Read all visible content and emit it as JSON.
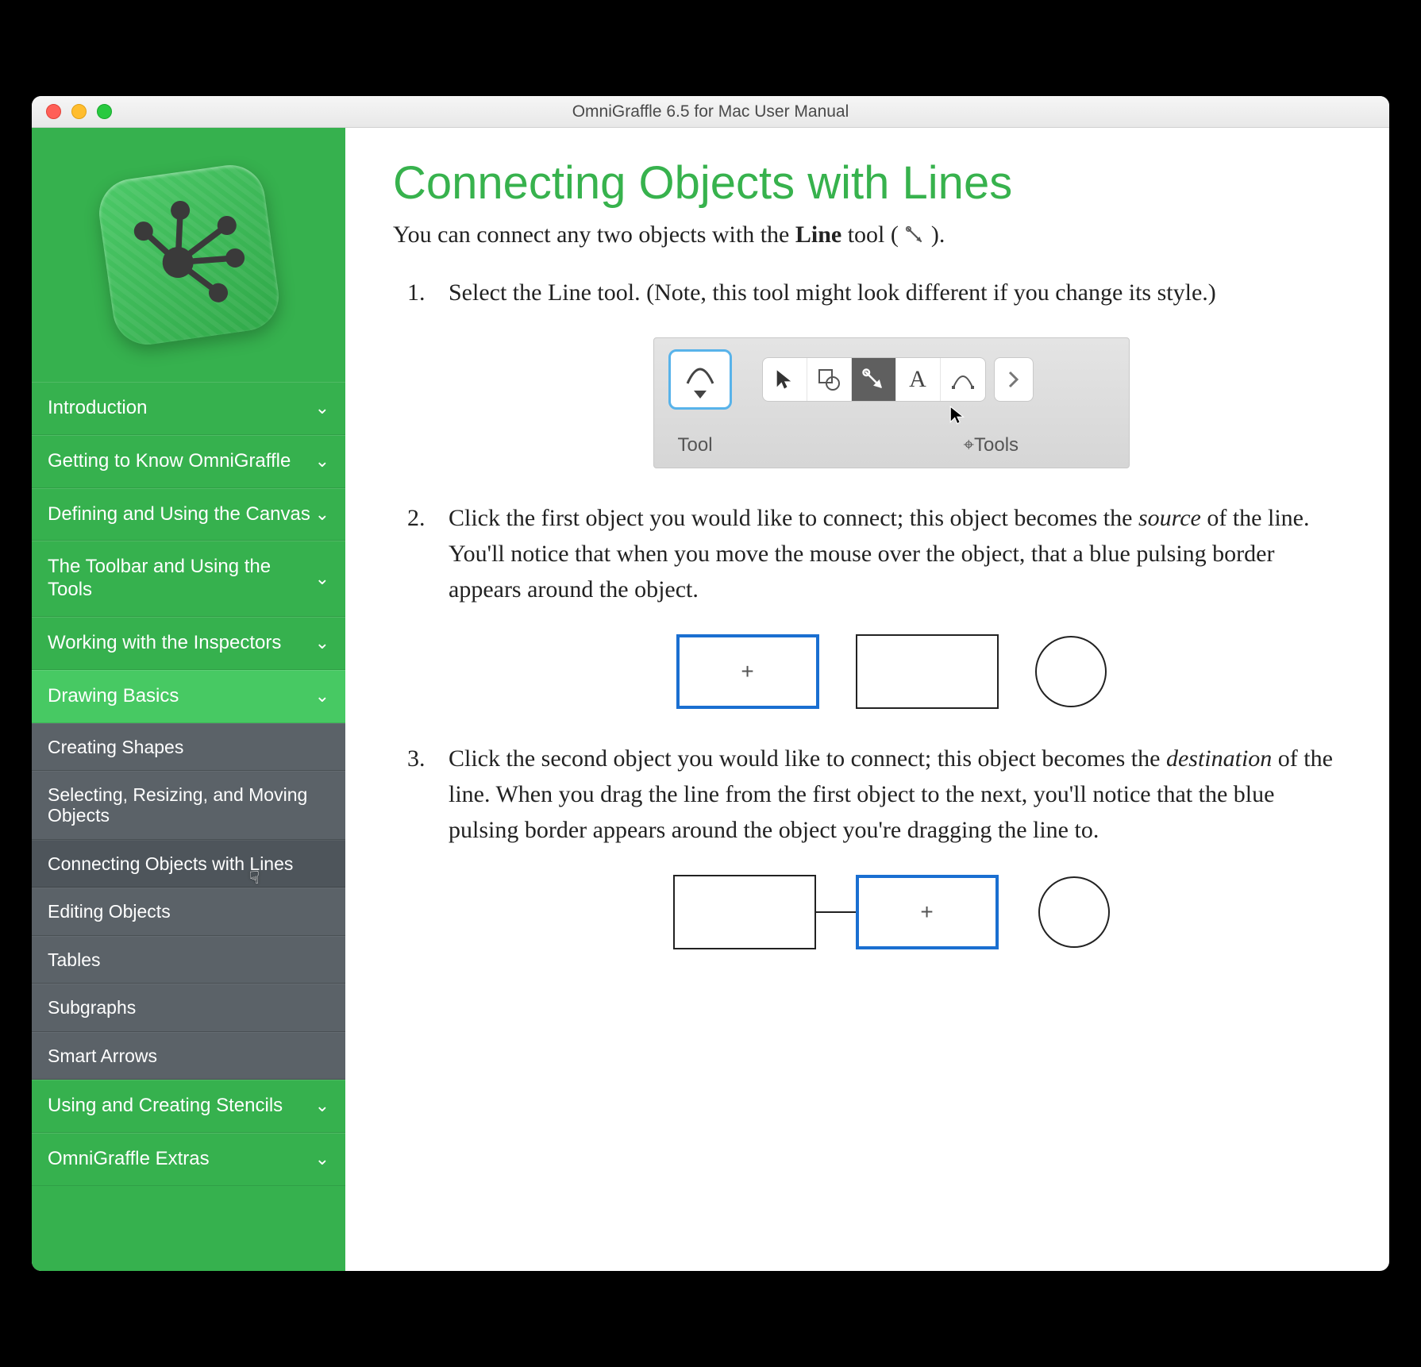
{
  "window": {
    "title": "OmniGraffle 6.5 for Mac User Manual"
  },
  "sidebar": {
    "sections": [
      {
        "label": "Introduction"
      },
      {
        "label": "Getting to Know OmniGraffle"
      },
      {
        "label": "Defining and Using the Canvas"
      },
      {
        "label": "The Toolbar and Using the Tools"
      },
      {
        "label": "Working with the Inspectors"
      },
      {
        "label": "Drawing Basics"
      },
      {
        "label": "Using and Creating Stencils"
      },
      {
        "label": "OmniGraffle Extras"
      }
    ],
    "drawing_basics_children": [
      {
        "label": "Creating Shapes"
      },
      {
        "label": "Selecting, Resizing, and Moving Objects"
      },
      {
        "label": "Connecting Objects with Lines"
      },
      {
        "label": "Editing Objects"
      },
      {
        "label": "Tables"
      },
      {
        "label": "Subgraphs"
      },
      {
        "label": "Smart Arrows"
      }
    ]
  },
  "page": {
    "title": "Connecting Objects with Lines",
    "intro_pre": "You can connect any two objects with the ",
    "intro_bold": "Line",
    "intro_post": " tool ( ",
    "intro_end": " ).",
    "steps": {
      "s1": "Select the Line tool. (Note, this tool might look different if you change its style.)",
      "s2a": "Click the first object you would like to connect; this object becomes the ",
      "s2em": "source",
      "s2b": " of the line. You'll notice that when you move the mouse over the object, that a blue pulsing border appears around the object.",
      "s3a": "Click the second object you would like to connect; this object becomes the ",
      "s3em": "destination",
      "s3b": " of the line. When you drag the line from the first object to the next, you'll notice that the blue pulsing border appears around the object you're dragging the line to."
    },
    "toolbar_labels": {
      "tool": "Tool",
      "tools": "Tools"
    }
  }
}
